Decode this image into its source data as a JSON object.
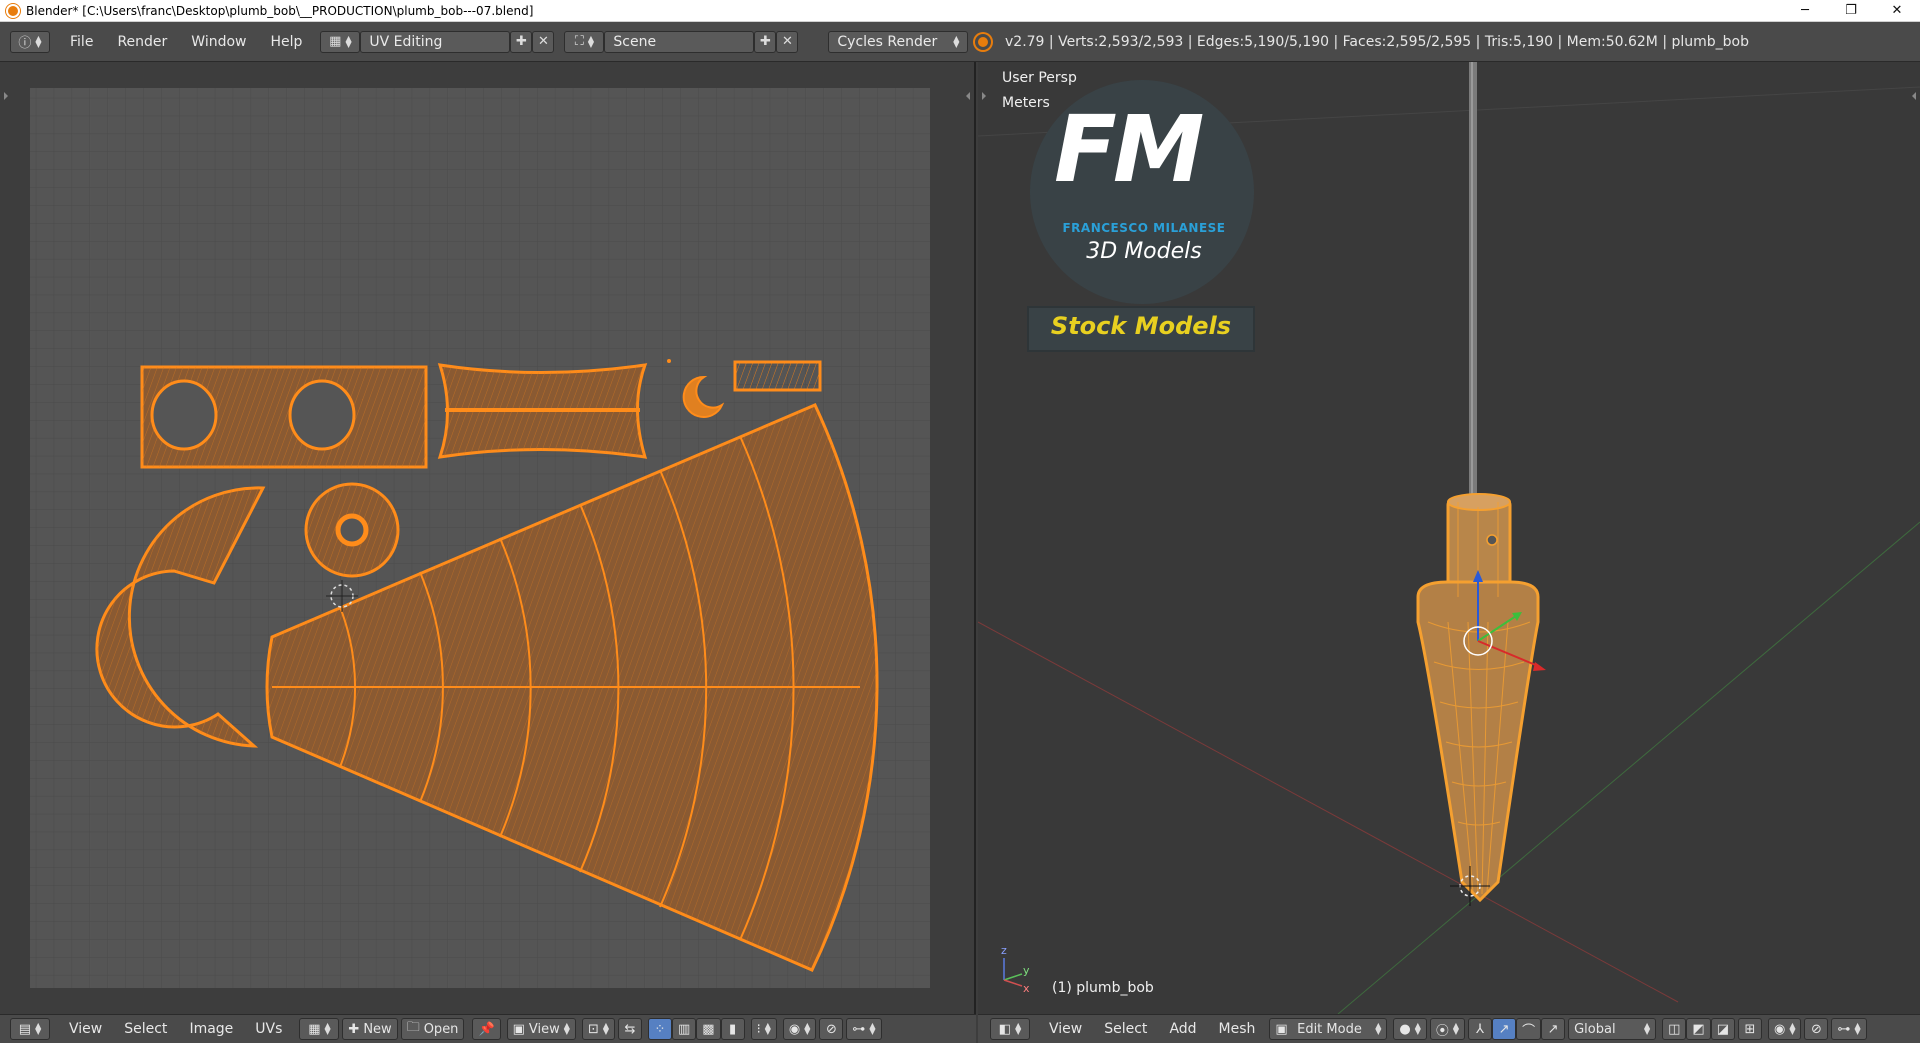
{
  "titlebar": {
    "title": "Blender* [C:\\Users\\franc\\Desktop\\plumb_bob\\__PRODUCTION\\plumb_bob---07.blend]",
    "minimize": "─",
    "restore": "❐",
    "close": "✕"
  },
  "topbar": {
    "menus": [
      "File",
      "Render",
      "Window",
      "Help"
    ],
    "layout_name": "UV Editing",
    "scene_name": "Scene",
    "render_engine": "Cycles Render",
    "stats": "v2.79 | Verts:2,593/2,593 | Edges:5,190/5,190 | Faces:2,595/2,595 | Tris:5,190 | Mem:50.62M | plumb_bob"
  },
  "viewport": {
    "view_name": "User Persp",
    "units": "Meters",
    "object_label": "(1) plumb_bob",
    "watermark": {
      "logo_text": "FM",
      "author": "FRANCESCO MILANESE",
      "subtitle": "3D Models",
      "badge": "Stock Models"
    }
  },
  "uv_footer": {
    "menus": [
      "View",
      "Select",
      "Image",
      "UVs"
    ],
    "new_label": "New",
    "open_label": "Open",
    "view_label": "View"
  },
  "vp_footer": {
    "menus": [
      "View",
      "Select",
      "Add",
      "Mesh"
    ],
    "mode": "Edit Mode",
    "orientation": "Global"
  },
  "colors": {
    "uv_grid_bg": "#555555",
    "uv_island": "#ff8c1a",
    "uv_fill": "#8a5a32",
    "mesh_orange": "#f5a030",
    "badge_text": "#e8d020",
    "logo_blue": "#2aa0d8"
  }
}
